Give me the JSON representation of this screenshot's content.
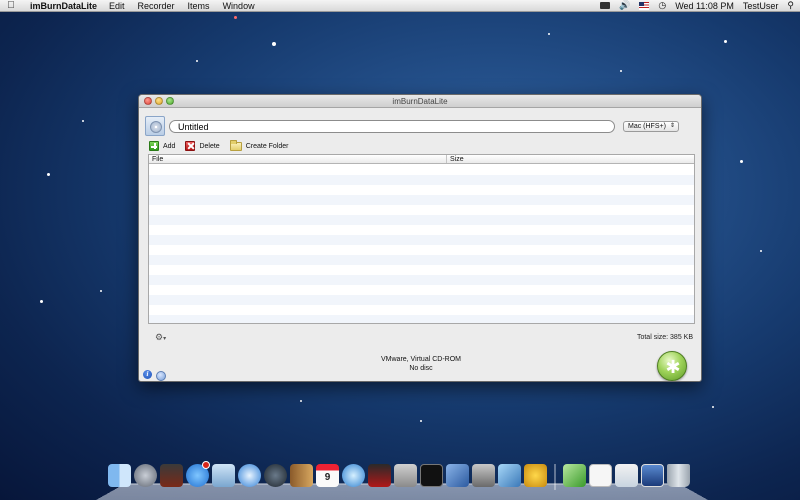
{
  "menubar": {
    "app_name": "imBurnDataLite",
    "menus": [
      "Edit",
      "Recorder",
      "Items",
      "Window"
    ],
    "clock": "Wed 11:08 PM",
    "user": "TestUser"
  },
  "window": {
    "title": "imBurnDataLite",
    "disc_name": "Untitled",
    "filesystem": "Mac (HFS+)",
    "toolbar": {
      "add_label": "Add",
      "delete_label": "Delete",
      "create_folder_label": "Create Folder"
    },
    "table": {
      "columns": [
        "File",
        "Size"
      ],
      "rows": []
    },
    "total_size": "Total size: 385 KB",
    "device": {
      "name": "VMware, Virtual CD-ROM",
      "status": "No disc"
    }
  },
  "colors": {
    "desktop_blue": "#1e4a86",
    "burn_green": "#8cc84b"
  },
  "dock": {
    "items": [
      "finder-icon",
      "launchpad-icon",
      "photo-booth-icon",
      "app-store-icon",
      "mail-icon",
      "safari-icon",
      "facetime-icon",
      "address-book-icon",
      "ical-icon",
      "itunes-icon",
      "photo-icon",
      "preview-icon",
      "terminal-icon",
      "xcode-icon",
      "installer-icon",
      "activity-monitor-icon",
      "burn-icon",
      "script-editor-icon",
      "document-icon",
      "folder-icon",
      "desktop-icon",
      "trash-icon"
    ],
    "calendar_day": "9"
  }
}
